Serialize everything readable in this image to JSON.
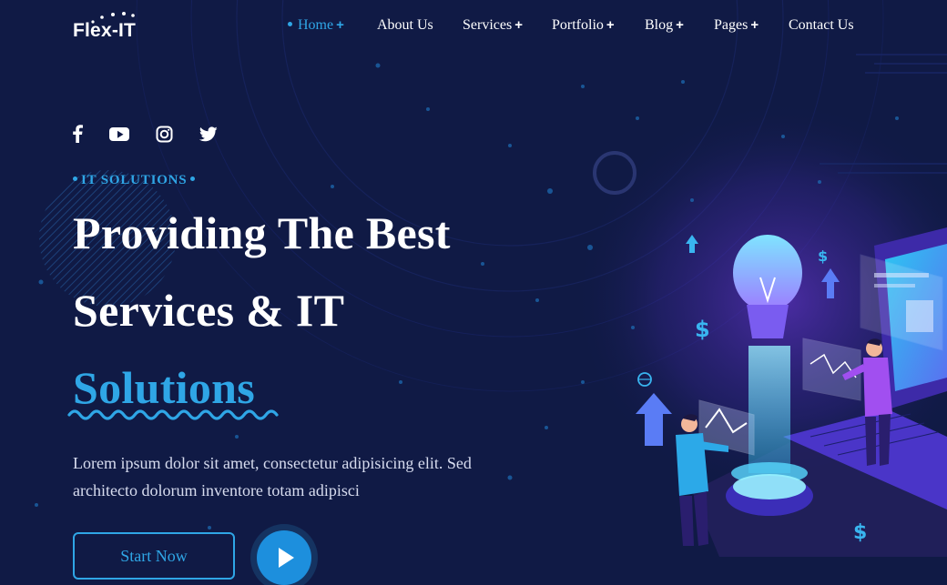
{
  "brand": {
    "name": "Flex-IT"
  },
  "nav": {
    "items": [
      {
        "label": "Home",
        "active": true,
        "has_dropdown": true
      },
      {
        "label": "About Us",
        "active": false,
        "has_dropdown": false
      },
      {
        "label": "Services",
        "active": false,
        "has_dropdown": true
      },
      {
        "label": "Portfolio",
        "active": false,
        "has_dropdown": true
      },
      {
        "label": "Blog",
        "active": false,
        "has_dropdown": true
      },
      {
        "label": "Pages",
        "active": false,
        "has_dropdown": true
      },
      {
        "label": "Contact Us",
        "active": false,
        "has_dropdown": false
      }
    ],
    "plus_symbol": "+"
  },
  "social": [
    "facebook-icon",
    "youtube-icon",
    "instagram-icon",
    "twitter-icon"
  ],
  "hero": {
    "eyebrow": "IT SOLUTIONS",
    "title_line1": "Providing The Best",
    "title_line2": "Services & IT",
    "title_line3": "Solutions",
    "description": "Lorem ipsum dolor sit amet, consectetur adipisicing elit. Sed architecto dolorum inventore totam adipisci",
    "cta_label": "Start Now"
  },
  "colors": {
    "background": "#101a45",
    "accent": "#2fa6e6",
    "text": "#ffffff",
    "violet": "#8a3cf0"
  }
}
